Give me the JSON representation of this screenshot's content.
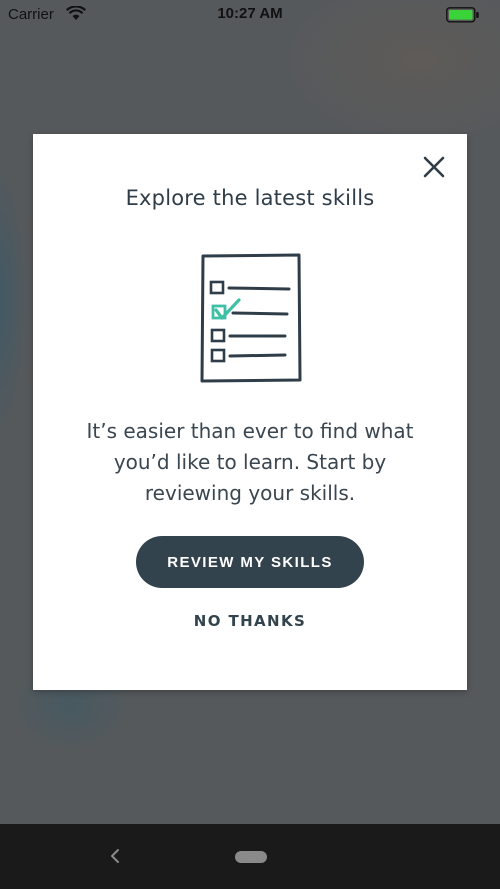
{
  "status_bar": {
    "carrier": "Carrier",
    "time": "10:27 AM",
    "battery_color": "#3ad33a"
  },
  "modal": {
    "title": "Explore the latest skills",
    "body": "It’s easier than ever to find what you’d like to learn. Start by reviewing your skills.",
    "primary_button_label": "REVIEW MY SKILLS",
    "secondary_button_label": "NO THANKS",
    "close_icon": "close-icon",
    "illustration_icon": "checklist-document-icon",
    "accent_color": "#3fbfa6",
    "primary_button_color": "#33434d"
  },
  "nav_bar": {
    "back_icon": "chevron-left-icon",
    "home_icon": "home-pill-icon"
  }
}
